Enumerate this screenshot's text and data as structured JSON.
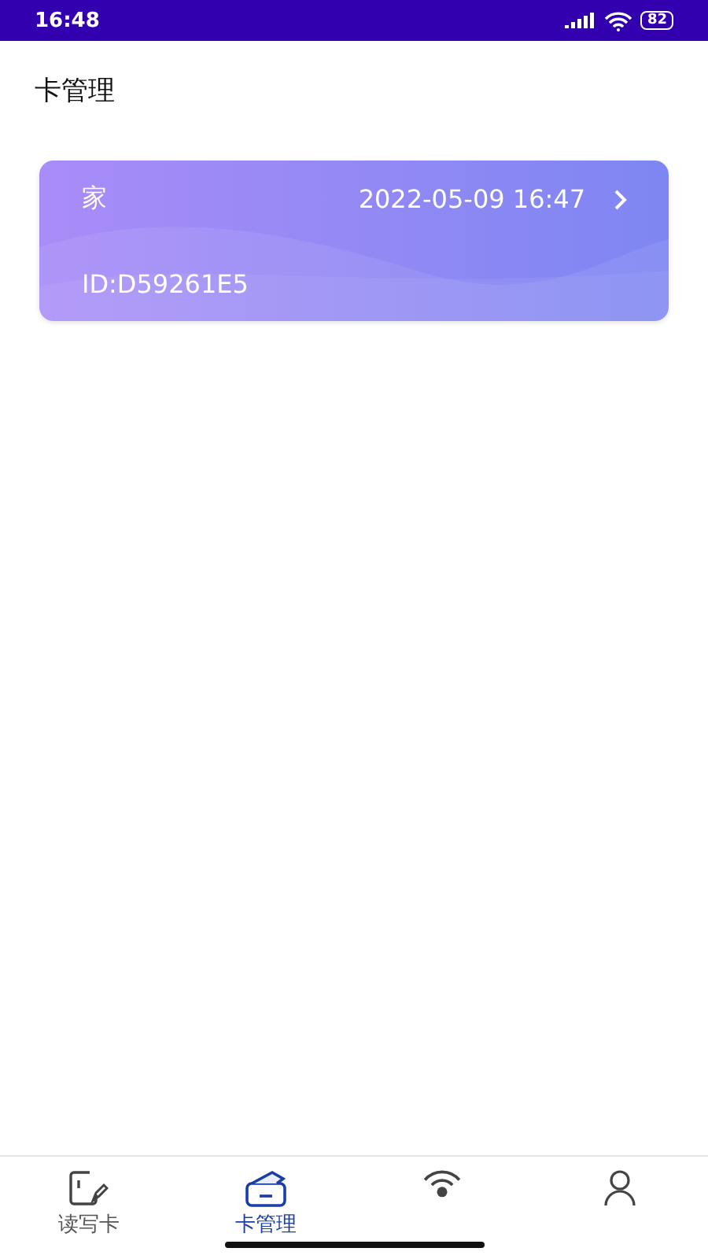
{
  "status_bar": {
    "time": "16:48",
    "battery": "82"
  },
  "header": {
    "title": "卡管理"
  },
  "cards": [
    {
      "name": "家",
      "time": "2022-05-09 16:47",
      "id": "ID:D59261E5"
    }
  ],
  "tab_bar": {
    "tabs": [
      {
        "kind": "edit",
        "label": "读写卡",
        "selected": false
      },
      {
        "kind": "card",
        "label": "卡管理",
        "selected": true
      },
      {
        "kind": "signal",
        "selected": false
      },
      {
        "kind": "user",
        "selected": false
      }
    ]
  }
}
